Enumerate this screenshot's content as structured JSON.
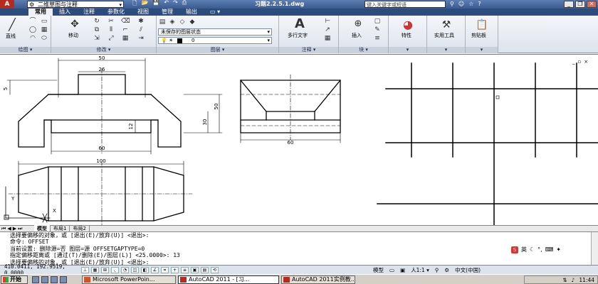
{
  "titlebar": {
    "logo": "A",
    "workspace": "二维草图与注释",
    "title": "习题2.2.5.1.dwg",
    "search_placeholder": "键入关键字或短语",
    "buttons": {
      "minimize": "_",
      "restore": "❐",
      "close": "✕"
    }
  },
  "ribbon_tabs": [
    "常用",
    "插入",
    "注释",
    "参数化",
    "视图",
    "管理",
    "输出",
    "▭ ▾"
  ],
  "ribbon": {
    "draw": {
      "title": "绘图",
      "line_label": "直线"
    },
    "modify": {
      "title": "修改",
      "move_label": "移动"
    },
    "layers": {
      "title": "图层",
      "state": "未保存的图层状态",
      "current_layer": "0"
    },
    "annotation": {
      "title": "注释",
      "mtext_label": "多行文字"
    },
    "block": {
      "title": "块",
      "insert_label": "插入"
    },
    "properties": {
      "label": "特性"
    },
    "utilities": {
      "label": "实用工具"
    },
    "clipboard": {
      "label": "剪贴板"
    }
  },
  "drawing": {
    "dimensions": {
      "top_width": "50",
      "top_inner": "26",
      "left_small": "5",
      "right_height": "30",
      "right_outer": "50",
      "middle_small": "12",
      "bottom_width": "60",
      "side_width": "60",
      "plan_width": "100"
    },
    "viewport_buttons": [
      "_",
      "▫",
      "×"
    ],
    "ucs_y": "Y",
    "ucs_x": "X"
  },
  "layout_tabs": [
    "模型",
    "布局1",
    "布局2"
  ],
  "command_lines": [
    "选择要偏移的对象，或 [退出(E)/放弃(U)] <退出>:",
    "命令:  OFFSET",
    "当前设置: 删除源=否  图层=源  OFFSETGAPTYPE=0",
    "指定偏移距离或 [通过(T)/删除(E)/图层(L)] <25.0000>:  13",
    "选择要偏移的对象，或 [退出(E)/放弃(U)] <退出>:"
  ],
  "ime": {
    "logo": "S",
    "lang": "英"
  },
  "status": {
    "coords": "410.0411, 192.9519, 0.0000",
    "model": "模型",
    "scale": "人1:1 ▾",
    "ime_lang": "中文(中国)"
  },
  "taskbar": {
    "start": "开始",
    "tasks": [
      "Microsoft PowerPoin...",
      "AutoCAD 2011 - [习...",
      "AutoCAD 2011实例教..."
    ],
    "time": "11:44"
  }
}
